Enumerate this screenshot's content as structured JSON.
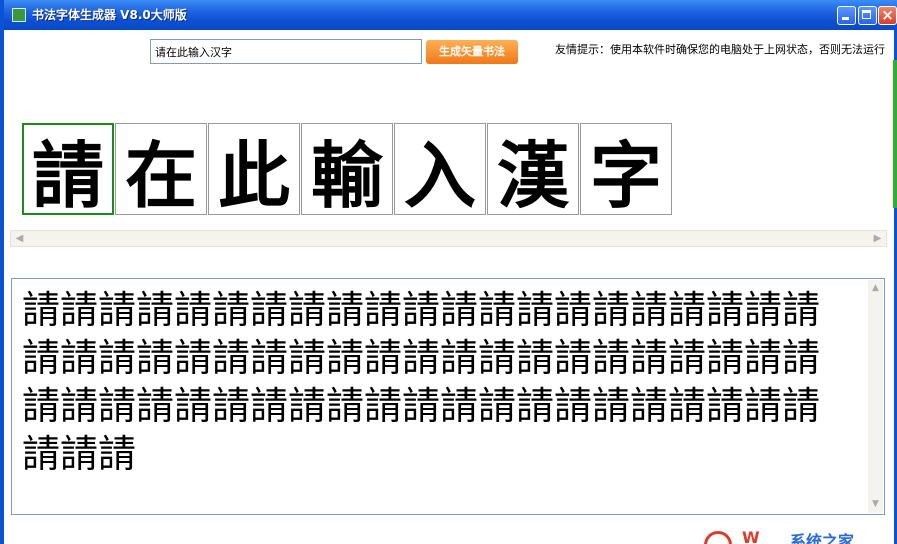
{
  "window": {
    "title": "书法字体生成器 V8.0大师版",
    "accent_color": "#0a52d6"
  },
  "toolbar": {
    "input_value": "请在此输入汉字",
    "generate_label": "生成矢量书法",
    "tip": "友情提示：使用本软件时确保您的电脑处于上网状态，否则无法运行"
  },
  "characters": [
    "請",
    "在",
    "此",
    "輸",
    "入",
    "漢",
    "字"
  ],
  "variants_text": "請請請請請請請請請請請請請請請請請請請請請請請請請請請請請請請請請請請請請請請請請請請請請請請請請請請請請請請請請請請請請請請請請請",
  "watermark": {
    "text": "系统之家",
    "icon": "watermark-logo-icon"
  }
}
